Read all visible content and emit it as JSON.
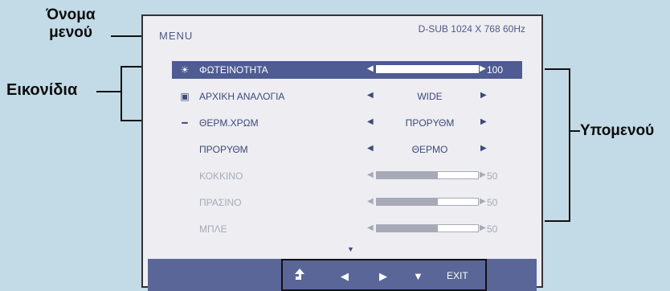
{
  "annotations": {
    "menu_name_line1": "Όνομα",
    "menu_name_line2": "μενού",
    "icons": "Εικονίδια",
    "submenu": "Υπομενού"
  },
  "header": {
    "title": "MENU",
    "resolution": "D-SUB 1024 X 768 60Hz"
  },
  "menu": {
    "items": [
      {
        "label": "ΦΩΤΕΙΝΟΤΗΤΑ",
        "icon": "sun-icon",
        "type": "slider",
        "value": "100",
        "fill_percent": 100,
        "selected": true
      },
      {
        "label": "ΑΡΧΙΚΗ ΑΝΑΛΟΓΙΑ",
        "icon": "monitor-icon",
        "type": "option",
        "value": "WIDE"
      },
      {
        "label": "ΘΕΡΜ.ΧΡΩΜ",
        "icon": "thermometer-icon",
        "type": "option",
        "value": "ΠΡΟΡΥΘΜ"
      },
      {
        "label": "ΠΡΟΡΥΘΜ",
        "type": "option",
        "value": "ΘΕΡΜΟ"
      },
      {
        "label": "ΚΟΚΚΙΝΟ",
        "type": "slider",
        "value": "50",
        "fill_percent": 60,
        "disabled": true
      },
      {
        "label": "ΠΡΑΣΙΝΟ",
        "type": "slider",
        "value": "50",
        "fill_percent": 60,
        "disabled": true
      },
      {
        "label": "ΜΠΛΕ",
        "type": "slider",
        "value": "50",
        "fill_percent": 60,
        "disabled": true
      }
    ]
  },
  "footer": {
    "buttons": [
      {
        "name": "up-arrow-icon"
      },
      {
        "name": "left-arrow-icon"
      },
      {
        "name": "right-arrow-icon"
      },
      {
        "name": "down-arrow-icon"
      },
      {
        "label": "EXIT"
      }
    ]
  }
}
